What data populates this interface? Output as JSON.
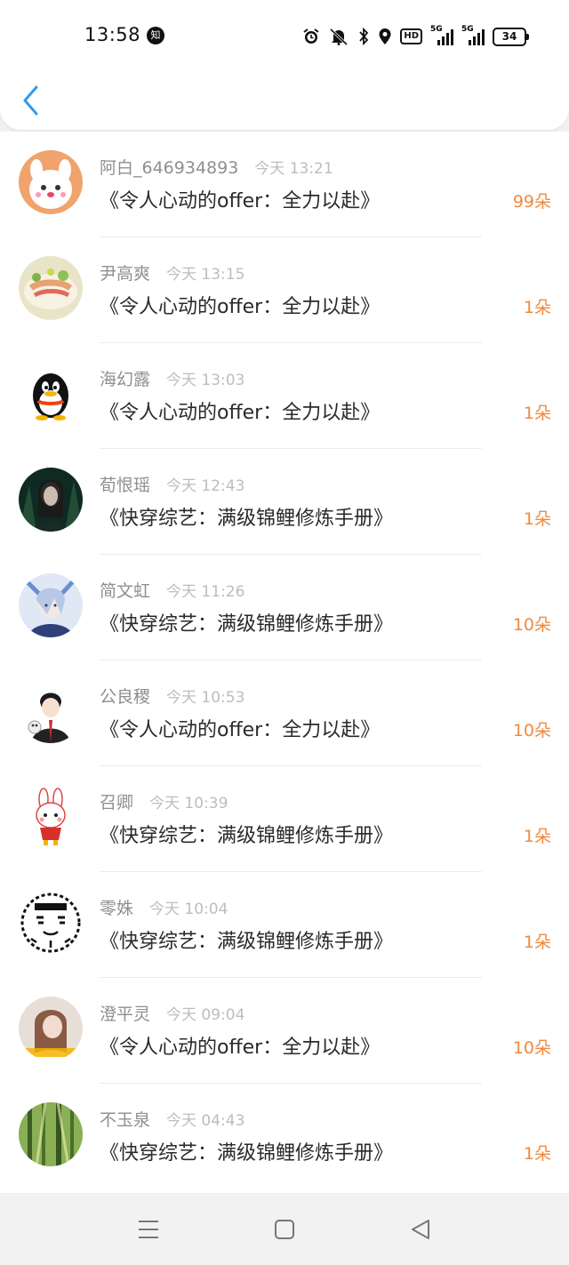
{
  "status": {
    "time": "13:58",
    "app_badge": "知",
    "hd_label": "HD",
    "net_1": "5G",
    "net_2": "5G",
    "battery": "34"
  },
  "header": {
    "back_icon": "chevron-left-icon",
    "accent_color": "#2f9bf0"
  },
  "colors": {
    "gift": "#ef8a3f",
    "name": "#8f8f8f",
    "time": "#bdbdbd"
  },
  "items": [
    {
      "name": "阿白_646934893",
      "time": "今天 13:21",
      "book": "《令人心动的offer：全力以赴》",
      "gift": "99朵"
    },
    {
      "name": "尹高爽",
      "time": "今天 13:15",
      "book": "《令人心动的offer：全力以赴》",
      "gift": "1朵"
    },
    {
      "name": "海幻露",
      "time": "今天 13:03",
      "book": "《令人心动的offer：全力以赴》",
      "gift": "1朵"
    },
    {
      "name": "荀恨瑶",
      "time": "今天 12:43",
      "book": "《快穿综艺：满级锦鲤修炼手册》",
      "gift": "1朵"
    },
    {
      "name": "简文虹",
      "time": "今天 11:26",
      "book": "《快穿综艺：满级锦鲤修炼手册》",
      "gift": "10朵"
    },
    {
      "name": "公良稷",
      "time": "今天 10:53",
      "book": "《令人心动的offer：全力以赴》",
      "gift": "10朵"
    },
    {
      "name": "召卿",
      "time": "今天 10:39",
      "book": "《快穿综艺：满级锦鲤修炼手册》",
      "gift": "1朵"
    },
    {
      "name": "零姝",
      "time": "今天 10:04",
      "book": "《快穿综艺：满级锦鲤修炼手册》",
      "gift": "1朵"
    },
    {
      "name": "澄平灵",
      "time": "今天 09:04",
      "book": "《令人心动的offer：全力以赴》",
      "gift": "10朵"
    },
    {
      "name": "不玉泉",
      "time": "今天 04:43",
      "book": "《快穿综艺：满级锦鲤修炼手册》",
      "gift": "1朵"
    }
  ],
  "nav": {
    "menu_icon": "menu-icon",
    "home_icon": "square-home-icon",
    "back_icon": "triangle-back-icon"
  }
}
